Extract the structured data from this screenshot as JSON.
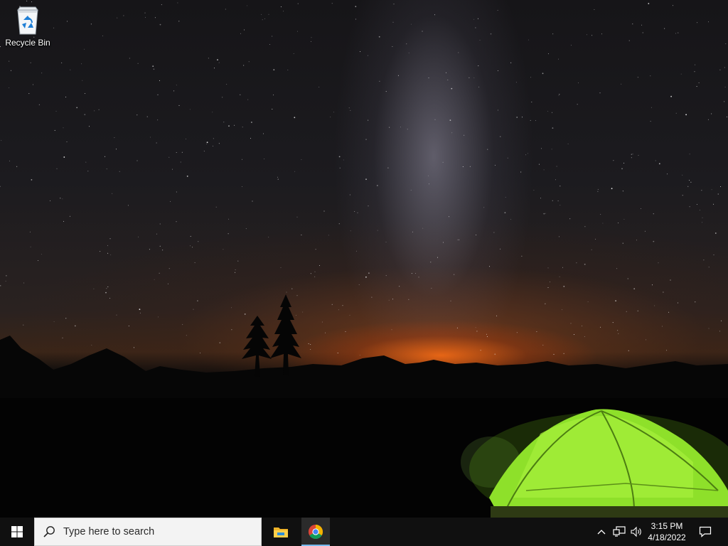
{
  "desktop": {
    "icons": [
      {
        "label": "Recycle Bin",
        "icon": "recycle-bin-icon"
      }
    ],
    "wallpaper": {
      "subject": "night sky over mountains with a lit tent",
      "colors": {
        "sky": "#1c1b1f",
        "glow": "#ff6e14",
        "tent": "#8ee02a"
      }
    }
  },
  "taskbar": {
    "start_icon": "windows-logo-icon",
    "search": {
      "placeholder": "Type here to search",
      "icon": "search-icon"
    },
    "apps": [
      {
        "name": "File Explorer",
        "icon": "folder-icon",
        "active": false
      },
      {
        "name": "Google Chrome",
        "icon": "chrome-icon",
        "active": true
      }
    ],
    "tray": {
      "icons": [
        "chevron-up-icon",
        "network-icon",
        "volume-icon"
      ],
      "time": "3:15 PM",
      "date": "4/18/2022",
      "notification_icon": "notification-icon"
    },
    "colors": {
      "background": "#101010",
      "active_indicator": "#76b9ed"
    }
  }
}
